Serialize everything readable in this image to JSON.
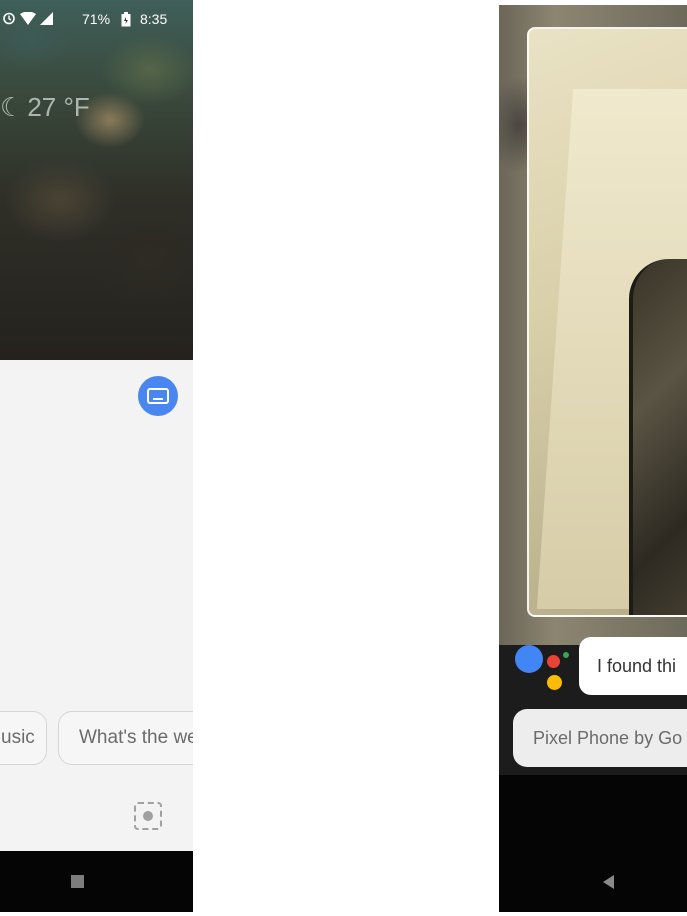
{
  "left_screen": {
    "status_bar": {
      "battery": "71%",
      "time": "8:35",
      "icons": [
        "alarm-icon",
        "wifi-icon",
        "signal-icon",
        "battery-icon"
      ]
    },
    "weather": {
      "icon": "moon-icon",
      "temperature": "27 °F"
    },
    "keyboard_button_color": "#4a86f0",
    "suggestion_chips": [
      {
        "label": "usic"
      },
      {
        "label": "What's the we"
      }
    ],
    "lens_icon": "lens-icon",
    "nav_icons": [
      "recents-icon"
    ]
  },
  "right_screen": {
    "assistant_colors": [
      "#4285f4",
      "#ea4335",
      "#fbbc05",
      "#34a853"
    ],
    "assistant_message": "I found thi",
    "suggestion_chip": "Pixel Phone by Go",
    "nav_icons": [
      "back-icon"
    ]
  }
}
